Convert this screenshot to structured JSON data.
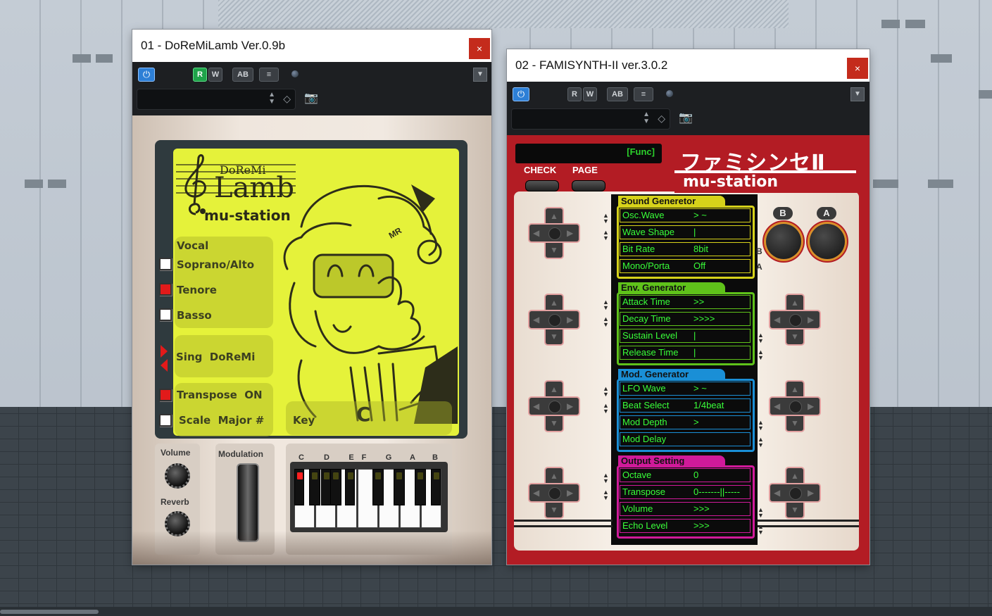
{
  "windows": [
    {
      "title": "01 - DoReMiLamb Ver.0.9b",
      "close_label": "×",
      "toolbar": {
        "power": "⏻",
        "r": "R",
        "w": "W",
        "ab": "AB",
        "eq": "≡"
      },
      "logo": {
        "small": "DoReMi",
        "big": "Lamb",
        "sub": "mu-station",
        "badge": "MR"
      },
      "vocal": {
        "heading": "Vocal",
        "options": [
          {
            "label": "Soprano/Alto",
            "checked": false
          },
          {
            "label": "Tenore",
            "checked": true
          },
          {
            "label": "Basso",
            "checked": false
          }
        ]
      },
      "sing_label": "Sing  DoReMi",
      "transpose_label": "Transpose  ON",
      "scale_label": "Scale  Major #",
      "key_label": "Key",
      "key_value": "C",
      "volume_label": "Volume",
      "reverb_label": "Reverb",
      "modulation_label": "Modulation",
      "note_labels": [
        "C",
        "D",
        "E",
        "F",
        "G",
        "A",
        "B"
      ]
    },
    {
      "title": "02 - FAMISYNTH-II ver.3.0.2",
      "close_label": "×",
      "toolbar": {
        "power": "⏻",
        "r": "R",
        "w": "W",
        "ab": "AB",
        "eq": "≡"
      },
      "lcd": "[Func]",
      "check_label": "CHECK",
      "page_label": "PAGE",
      "logo_jp": "ファミシンセⅡ",
      "logo_en": "mu-station",
      "b_label": "B",
      "a_label": "A",
      "side_b": "B",
      "side_a": "A",
      "sections": [
        {
          "name": "Sound Generetor",
          "color": "#d6d21a",
          "rows": [
            {
              "name": "Osc.Wave",
              "value": "> ~"
            },
            {
              "name": "Wave Shape",
              "value": "|"
            },
            {
              "name": "Bit Rate",
              "value": "8bit"
            },
            {
              "name": "Mono/Porta",
              "value": "Off"
            }
          ]
        },
        {
          "name": "Env. Generator",
          "color": "#5fc21a",
          "rows": [
            {
              "name": "Attack Time",
              "value": ">>"
            },
            {
              "name": "Decay Time",
              "value": ">>>>"
            },
            {
              "name": "Sustain Level",
              "value": "|"
            },
            {
              "name": "Release Time",
              "value": "|"
            }
          ]
        },
        {
          "name": "Mod. Generator",
          "color": "#1a8fd6",
          "rows": [
            {
              "name": "LFO Wave",
              "value": "> ~"
            },
            {
              "name": "Beat Select",
              "value": "1/4beat"
            },
            {
              "name": "Mod Depth",
              "value": ">"
            },
            {
              "name": "Mod Delay",
              "value": ""
            }
          ]
        },
        {
          "name": "Output Setting",
          "color": "#d01a9a",
          "rows": [
            {
              "name": "Octave",
              "value": "0"
            },
            {
              "name": "Transpose",
              "value": "0-------||-----"
            },
            {
              "name": "Volume",
              "value": ">>>"
            },
            {
              "name": "Echo Level",
              "value": ">>>"
            }
          ]
        }
      ]
    }
  ]
}
